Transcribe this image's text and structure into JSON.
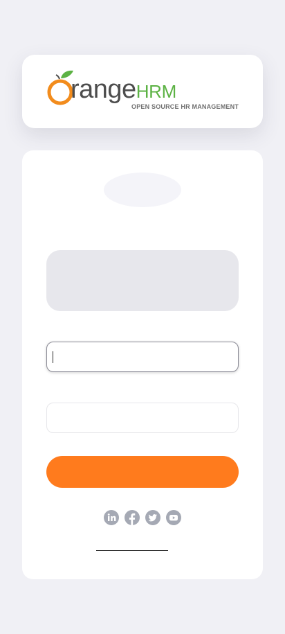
{
  "branding": {
    "logo_wordmark": "range",
    "logo_hrm": "HRM",
    "logo_tagline": "OPEN SOURCE HR MANAGEMENT",
    "brand_orange": "#ff7b1d",
    "brand_green": "#5cb244"
  },
  "login": {
    "username_value": "",
    "password_value": "",
    "login_button_label": ""
  },
  "social": {
    "icons": [
      "linkedin-icon",
      "facebook-icon",
      "twitter-icon",
      "youtube-icon"
    ]
  }
}
